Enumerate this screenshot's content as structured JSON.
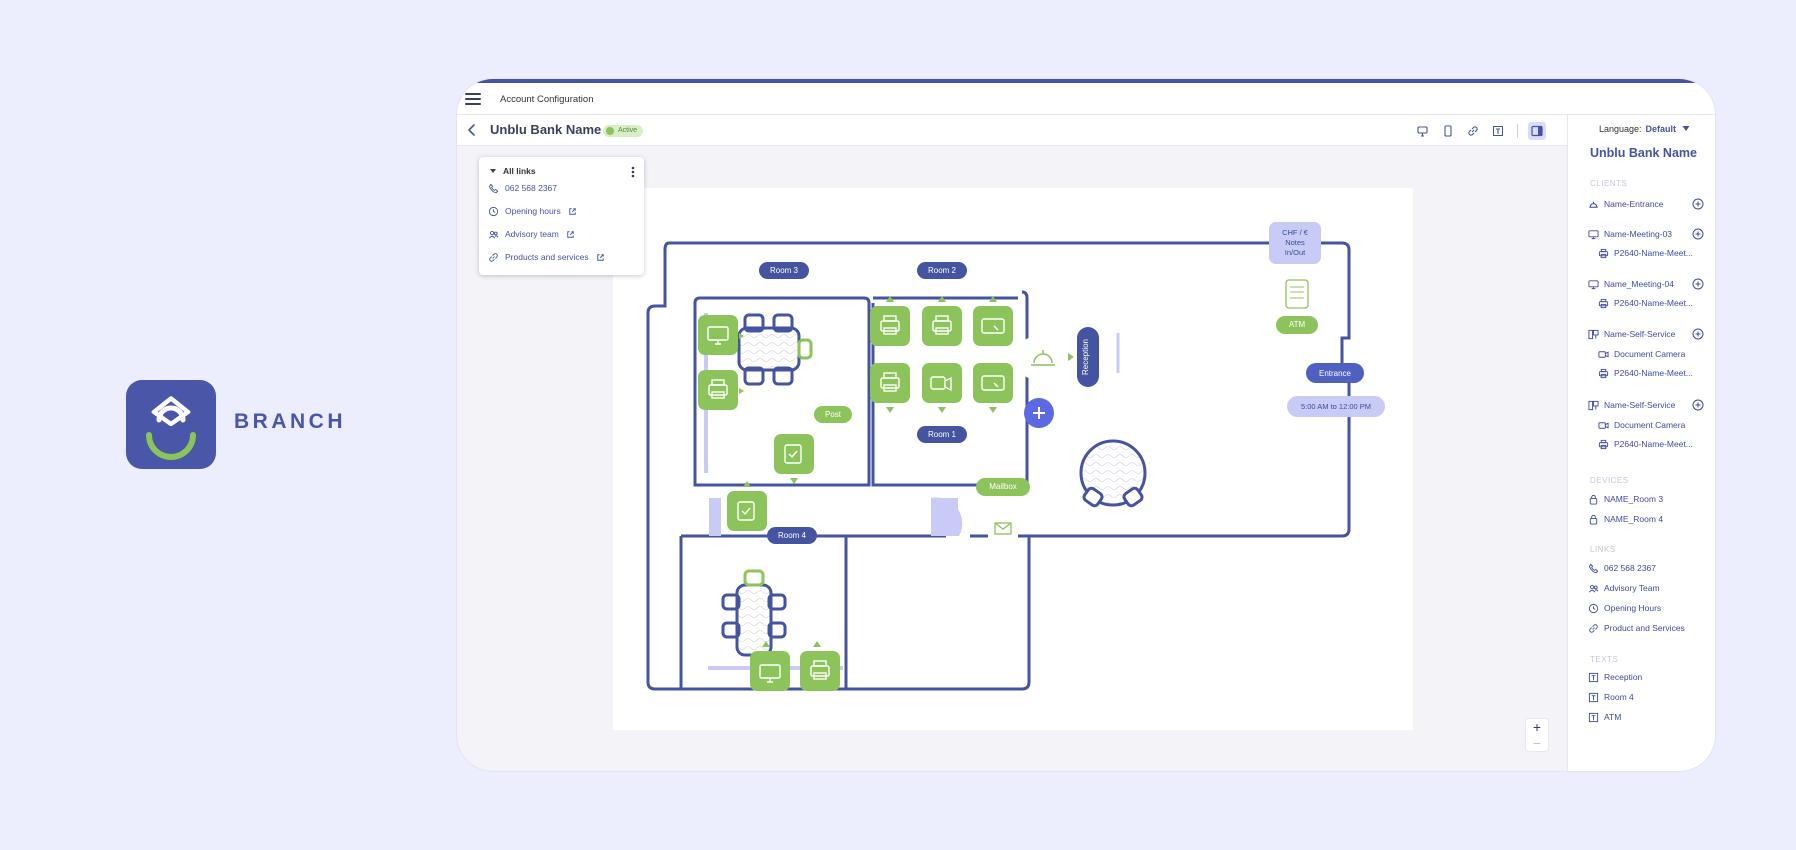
{
  "brand": {
    "name": "BRANCH"
  },
  "topbar": {
    "title": "Account Configuration"
  },
  "subheader": {
    "title": "Unblu Bank Name",
    "status": "Active"
  },
  "links_popover": {
    "header": "All links",
    "items": [
      {
        "label": "062 568 2367",
        "icon": "phone-icon",
        "external": false
      },
      {
        "label": "Opening hours",
        "icon": "clock-icon",
        "external": true
      },
      {
        "label": "Advisory team",
        "icon": "people-icon",
        "external": true
      },
      {
        "label": "Products and services",
        "icon": "link-icon",
        "external": true
      }
    ]
  },
  "floorplan": {
    "rooms": [
      "Room 3",
      "Room 2",
      "Room 1",
      "Room 4"
    ],
    "labels": {
      "post": "Post",
      "reception": "Reception",
      "mailbox": "Mailbox",
      "entrance": "Entrance",
      "atm": "ATM",
      "hours": "5:00 AM to 12:00 PM",
      "chf_1": "CHF / €",
      "chf_2": "Notes",
      "chf_3": "In/Out"
    }
  },
  "zoom": {
    "plus": "+",
    "minus": "−"
  },
  "right_panel": {
    "language_label": "Language:",
    "language_value": "Default",
    "title": "Unblu Bank Name",
    "sections": {
      "clients": "CLIENTS",
      "devices": "DEVICES",
      "links": "LINKS",
      "texts": "TEXTS"
    },
    "clients": [
      {
        "label": "Name-Entrance",
        "icon": "bell-icon",
        "sub": false,
        "add": true
      },
      {
        "label": "Name-Meeting-03",
        "icon": "monitor-icon",
        "sub": false,
        "add": true
      },
      {
        "label": "P2640-Name-Meet...",
        "icon": "printer-icon",
        "sub": true,
        "add": false
      },
      {
        "label": "Name_Meeting-04",
        "icon": "monitor-icon",
        "sub": false,
        "add": true
      },
      {
        "label": "P2640-Name-Meet...",
        "icon": "printer-icon",
        "sub": true,
        "add": false
      },
      {
        "label": "Name-Self-Service",
        "icon": "kiosk-icon",
        "sub": false,
        "add": true
      },
      {
        "label": "Document Camera",
        "icon": "camera-icon",
        "sub": true,
        "add": false
      },
      {
        "label": "P2640-Name-Meet...",
        "icon": "printer-icon",
        "sub": true,
        "add": false
      },
      {
        "label": "Name-Self-Service",
        "icon": "kiosk-icon",
        "sub": false,
        "add": true
      },
      {
        "label": "Document Camera",
        "icon": "camera-icon",
        "sub": true,
        "add": false
      },
      {
        "label": "P2640-Name-Meet...",
        "icon": "printer-icon",
        "sub": true,
        "add": false
      }
    ],
    "devices": [
      {
        "label": "NAME_Room 3",
        "icon": "lock-icon"
      },
      {
        "label": "NAME_Room 4",
        "icon": "lock-icon"
      }
    ],
    "links": [
      {
        "label": "062 568 2367",
        "icon": "phone-icon"
      },
      {
        "label": "Advisory Team",
        "icon": "people-icon"
      },
      {
        "label": "Opening Hours",
        "icon": "clock-icon"
      },
      {
        "label": "Product and Services",
        "icon": "link-icon"
      }
    ],
    "texts": [
      {
        "label": "Reception",
        "icon": "text-icon"
      },
      {
        "label": "Room 4",
        "icon": "text-icon"
      },
      {
        "label": "ATM",
        "icon": "text-icon"
      }
    ]
  }
}
